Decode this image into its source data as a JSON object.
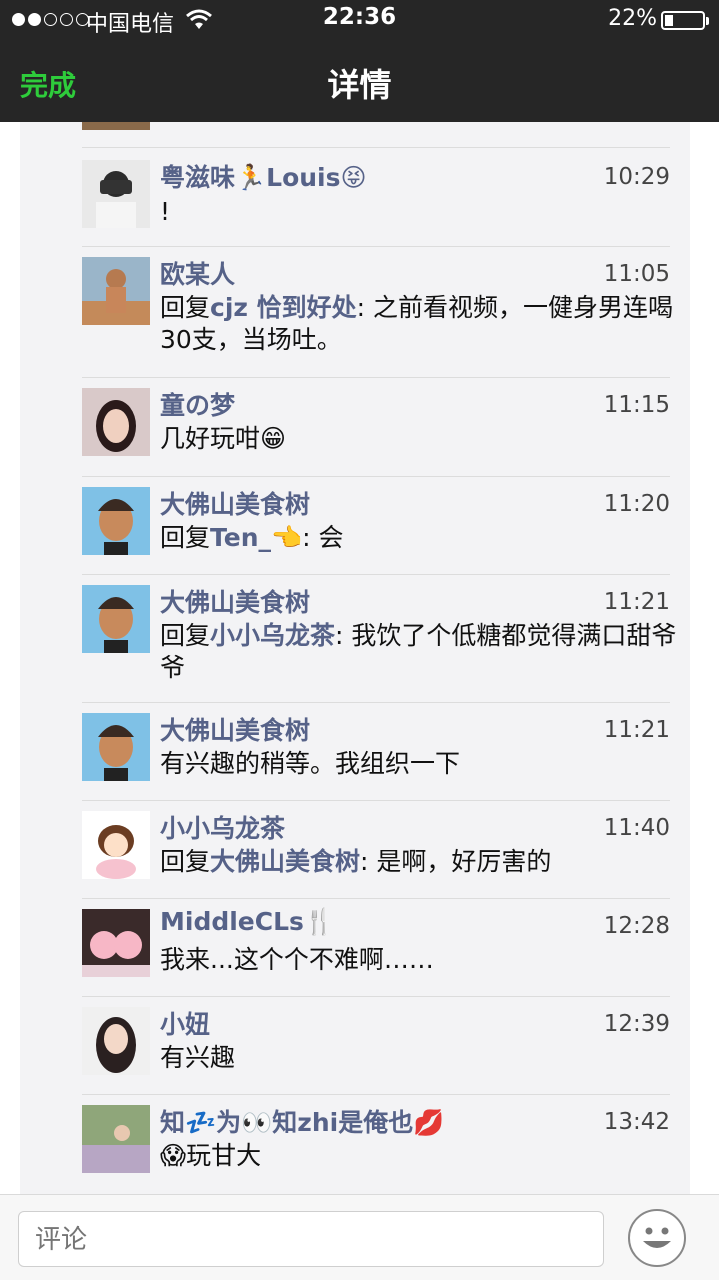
{
  "status": {
    "carrier": "中国电信",
    "time": "22:36",
    "battery": "22%",
    "battery_level": 0.22
  },
  "nav": {
    "done_label": "完成",
    "title": "详情"
  },
  "colors": {
    "accent_green": "#2ecc3b",
    "name_blue": "#566288",
    "topbar": "#262626"
  },
  "comments": [
    {
      "name": "粤滋味",
      "name_suffix": "Louis",
      "name_emoji_1": "🏃",
      "name_emoji_2": "😝",
      "time": "10:29",
      "text": "!"
    },
    {
      "name": "欧某人",
      "time": "11:05",
      "reply_prefix": "回复",
      "reply_to": "cjz 恰到好处",
      "reply_sep": ": ",
      "text": "之前看视频，一健身男连喝30支，当场吐。"
    },
    {
      "name": "童の梦",
      "time": "11:15",
      "text": "几好玩咁",
      "text_emoji": "😁"
    },
    {
      "name": "大佛山美食树",
      "time": "11:20",
      "reply_prefix": "回复",
      "reply_to": "Ten_👈",
      "reply_sep": ": ",
      "text": "会"
    },
    {
      "name": "大佛山美食树",
      "time": "11:21",
      "reply_prefix": "回复",
      "reply_to": "小小乌龙茶",
      "reply_sep": ": ",
      "text": "我饮了个低糖都觉得满口甜爷爷"
    },
    {
      "name": "大佛山美食树",
      "time": "11:21",
      "text": "有兴趣的稍等。我组织一下"
    },
    {
      "name": "小小乌龙茶",
      "time": "11:40",
      "reply_prefix": "回复",
      "reply_to": "大佛山美食树",
      "reply_sep": ": ",
      "text": "是啊，好厉害的"
    },
    {
      "name": "MiddleCLs",
      "name_emoji_2": "🍴",
      "time": "12:28",
      "text": "我来...这个个不难啊……"
    },
    {
      "name": "小妞",
      "time": "12:39",
      "text": "有兴趣"
    },
    {
      "name": "知",
      "name_suffix": "为👀知zhi是俺也",
      "name_emoji_1": "💤",
      "name_emoji_2": "💋",
      "time": "13:42",
      "text": "玩甘大",
      "text_emoji_pre": "😱"
    }
  ],
  "input": {
    "placeholder": "评论"
  },
  "icons": {
    "emoji_button": "smiley-icon"
  }
}
